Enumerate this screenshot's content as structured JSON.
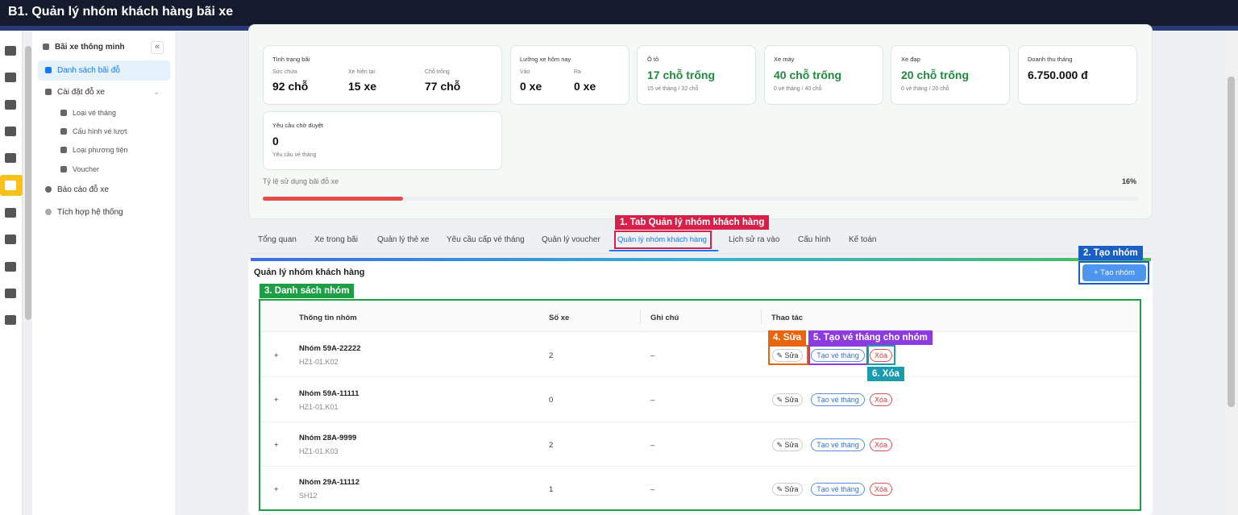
{
  "window": {
    "title": "B1. Quản lý nhóm khách hàng bãi xe"
  },
  "sidebar": {
    "collapse_icon": "«",
    "header": "Bãi xe thông minh",
    "items": [
      {
        "label": "Danh sách bãi đỗ",
        "active": true
      },
      {
        "label": "Cài đặt đỗ xe"
      },
      {
        "label": "Loại vé tháng"
      },
      {
        "label": "Cấu hình vé lượt"
      },
      {
        "label": "Loại phương tiện"
      },
      {
        "label": "Voucher"
      },
      {
        "label": "Báo cáo đỗ xe"
      },
      {
        "label": "Tích hợp hệ thống"
      }
    ]
  },
  "stats": {
    "status": {
      "title": "Tình trạng bãi",
      "cap_label": "Sức chứa",
      "cap_value": "92 chỗ",
      "cur_label": "Xe hiện tại",
      "cur_value": "15 xe",
      "free_label": "Chỗ trống",
      "free_value": "77 chỗ"
    },
    "flow": {
      "title": "Lưỡng xe hôm nay",
      "in_label": "Vào",
      "in_value": "0 xe",
      "out_label": "Ra",
      "out_value": "0 xe"
    },
    "car": {
      "title": "Ô tô",
      "value": "17 chỗ trống",
      "sub": "15 vé tháng / 32 chỗ"
    },
    "moto": {
      "title": "Xe máy",
      "value": "40 chỗ trống",
      "sub": "0 vé tháng / 40 chỗ"
    },
    "bike": {
      "title": "Xe đạp",
      "value": "20 chỗ trống",
      "sub": "0 vé tháng / 20 chỗ"
    },
    "revenue": {
      "title": "Doanh thu tháng",
      "value": "6.750.000 đ"
    },
    "pending": {
      "title": "Yêu cầu chờ duyệt",
      "value": "0",
      "sub": "Yêu cầu vé tháng"
    },
    "usage": {
      "label": "Tỷ lệ sử dụng bãi đỗ xe",
      "value": "16%",
      "fraction": 0.16
    }
  },
  "tabs": [
    "Tổng quan",
    "Xe trong bãi",
    "Quản lý thẻ xe",
    "Yêu cầu cấp vé tháng",
    "Quản lý voucher",
    "Quản lý nhóm khách hàng",
    "Lịch sử ra vào",
    "Cấu hình",
    "Kế toán"
  ],
  "section": {
    "title": "Quản lý nhóm khách hàng",
    "create_button": "+ Tạo nhóm"
  },
  "table": {
    "headers": [
      "Thông tin nhóm",
      "Số xe",
      "Ghi chú",
      "Thao tác"
    ],
    "rows": [
      {
        "name": "Nhóm 59A-22222",
        "code": "HZ1-01.K02",
        "count": "2",
        "note": "–"
      },
      {
        "name": "Nhóm 59A-11111",
        "code": "HZ1-01.K01",
        "count": "0",
        "note": "–"
      },
      {
        "name": "Nhóm 28A-9999",
        "code": "HZ1-01.K03",
        "count": "2",
        "note": "–"
      },
      {
        "name": "Nhóm 29A-11112",
        "code": "SH12",
        "count": "1",
        "note": "–"
      }
    ],
    "expand": "+",
    "actions": {
      "edit": "✎ Sửa",
      "ticket": "Tạo vé tháng",
      "delete": "Xóa"
    }
  },
  "annotations": [
    {
      "text": "1. Tab Quản lý nhóm khách hàng",
      "color": "#d6204a"
    },
    {
      "text": "2. Tạo nhóm",
      "color": "#1a5fc4"
    },
    {
      "text": "3. Danh sách nhóm",
      "color": "#1e9e45"
    },
    {
      "text": "4. Sửa",
      "color": "#e8650e"
    },
    {
      "text": "5. Tạo vé tháng cho nhóm",
      "color": "#8c3be0"
    },
    {
      "text": "6. Xóa",
      "color": "#1a9bb0"
    }
  ]
}
